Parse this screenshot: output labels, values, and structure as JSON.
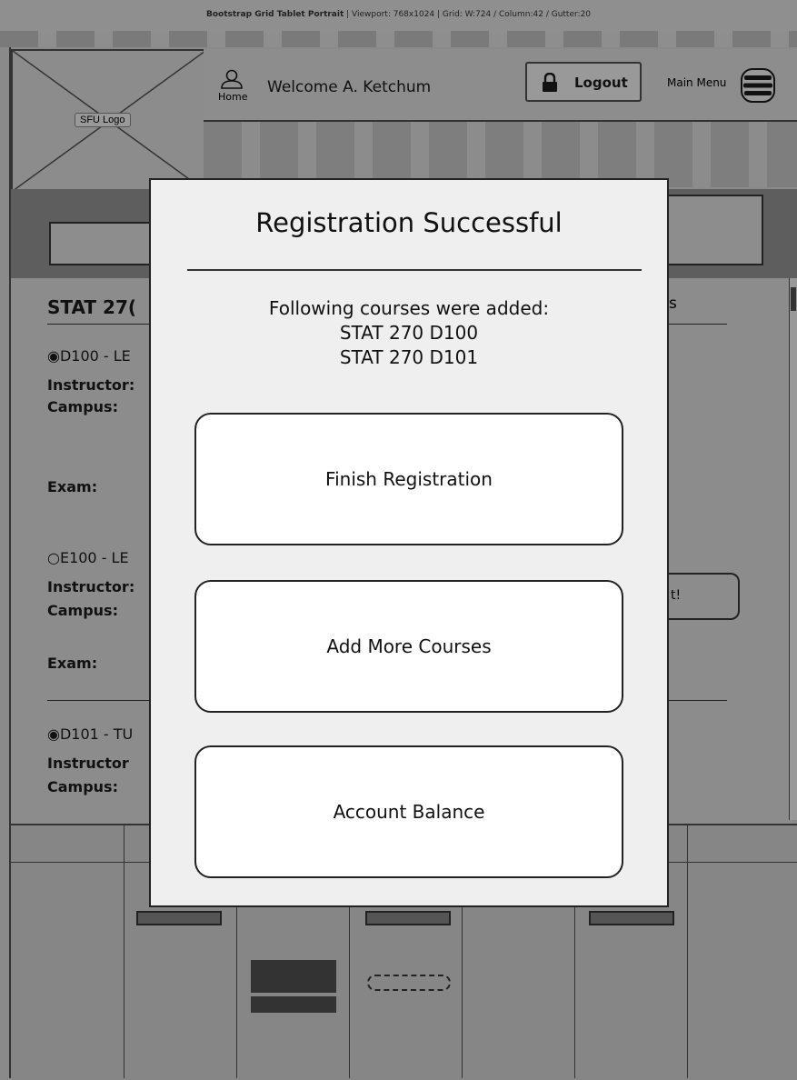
{
  "grid_caption": {
    "bold": "Bootstrap Grid Tablet Portrait",
    "rest": "  |  Viewport: 768x1024  |  Grid: W:724 / Column:42 / Gutter:20"
  },
  "logo": {
    "label": "SFU Logo"
  },
  "header": {
    "home_label": "Home",
    "welcome": "Welcome A. Ketchum",
    "logout_label": "Logout",
    "menu_label": "Main Menu"
  },
  "background": {
    "course_title": "STAT 27(",
    "sections": [
      {
        "radio": "◉D100 - LE",
        "instructor": "Instructor:",
        "campus": "Campus:",
        "exam": "Exam:"
      },
      {
        "radio": "○E100 - LE",
        "instructor": "Instructor:",
        "campus": "Campus:",
        "exam": "Exam:"
      },
      {
        "radio": "◉D101 - TU",
        "instructor": "Instructor",
        "campus": "Campus:"
      }
    ],
    "right_header": "s",
    "right_button": "t!"
  },
  "modal": {
    "title": "Registration Successful",
    "message_line": "Following courses were added:",
    "courses": [
      "STAT 270 D100",
      "STAT 270 D101"
    ],
    "buttons": {
      "finish": "Finish Registration",
      "add_more": "Add More Courses",
      "balance": "Account Balance"
    }
  },
  "icons": {
    "home": "home-person-icon",
    "lock": "lock-icon",
    "menu": "hamburger-menu-icon"
  }
}
